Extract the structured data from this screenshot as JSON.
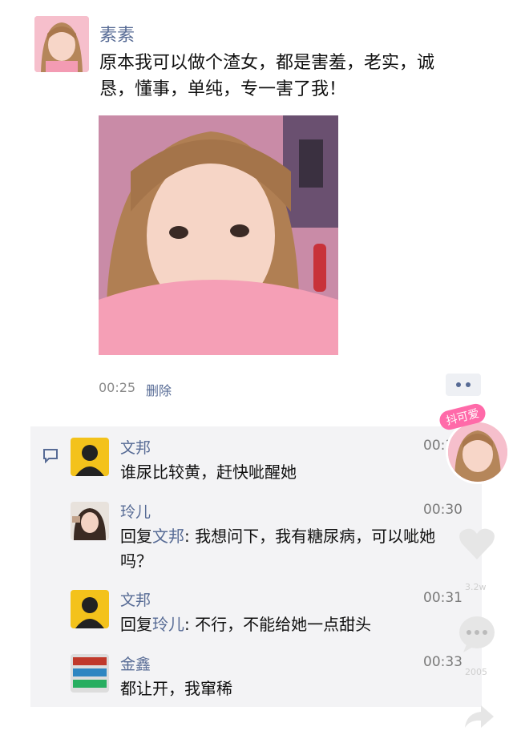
{
  "post": {
    "author": "素素",
    "text": "原本我可以做个渣女，都是害羞，老实，诚恳，懂事，单纯，专一害了我！",
    "time": "00:25",
    "delete_label": "删除"
  },
  "comments": [
    {
      "name": "文邦",
      "time": "00:31",
      "reply_prefix": "",
      "reply_to": "",
      "text": "谁尿比较黄，赶快呲醒她"
    },
    {
      "name": "玲儿",
      "time": "00:30",
      "reply_prefix": "回复",
      "reply_to": "文邦",
      "text": ": 我想问下，我有糖尿病，可以呲她吗？"
    },
    {
      "name": "文邦",
      "time": "00:31",
      "reply_prefix": "回复",
      "reply_to": "玲儿",
      "text": ": 不行，不能给她一点甜头"
    },
    {
      "name": "金鑫",
      "time": "00:33",
      "reply_prefix": "",
      "reply_to": "",
      "text": "都让开，我窜稀"
    }
  ],
  "overlay": {
    "follow_label": "抖可爱",
    "like_count": "3.2w",
    "comment_count": "2005"
  },
  "colors": {
    "link_blue": "#576b95",
    "panel_bg": "#f3f3f5"
  }
}
